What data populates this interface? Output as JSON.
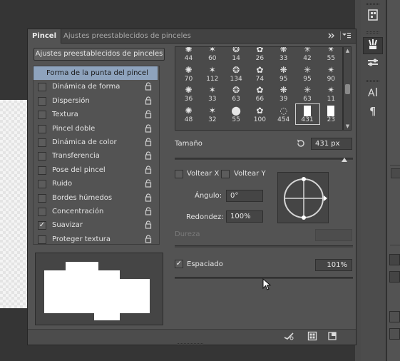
{
  "panel": {
    "tabs": [
      {
        "label": "Pincel",
        "active": true
      },
      {
        "label": "Ajustes preestablecidos de pinceles",
        "active": false
      }
    ],
    "collapse_icon": "double-chevron-right-icon",
    "menu_icon": "panel-menu-icon"
  },
  "presets_button": "Ajustes preestablecidos de pinceles",
  "options": [
    {
      "label": "Forma de la punta del pincel",
      "selected": true,
      "checkbox": false,
      "lock": false
    },
    {
      "label": "Dinámica de forma",
      "checked": false,
      "lock": true
    },
    {
      "label": "Dispersión",
      "checked": false,
      "lock": true
    },
    {
      "label": "Textura",
      "checked": false,
      "lock": true
    },
    {
      "label": "Pincel doble",
      "checked": false,
      "lock": true
    },
    {
      "label": "Dinámica de color",
      "checked": false,
      "lock": true
    },
    {
      "label": "Transferencia",
      "checked": false,
      "lock": true
    },
    {
      "label": "Pose del pincel",
      "checked": false,
      "lock": true
    },
    {
      "label": "Ruido",
      "checked": false,
      "lock": true
    },
    {
      "label": "Bordes húmedos",
      "checked": false,
      "lock": true
    },
    {
      "label": "Concentración",
      "checked": false,
      "lock": true
    },
    {
      "label": "Suavizar",
      "checked": true,
      "lock": true
    },
    {
      "label": "Proteger textura",
      "checked": false,
      "lock": true
    }
  ],
  "tips": [
    {
      "size": "44"
    },
    {
      "size": "60"
    },
    {
      "size": "14"
    },
    {
      "size": "26"
    },
    {
      "size": "33"
    },
    {
      "size": "42"
    },
    {
      "size": "55"
    },
    {
      "size": "70"
    },
    {
      "size": "112"
    },
    {
      "size": "134"
    },
    {
      "size": "74"
    },
    {
      "size": "95"
    },
    {
      "size": "95"
    },
    {
      "size": "90"
    },
    {
      "size": "36"
    },
    {
      "size": "33"
    },
    {
      "size": "63"
    },
    {
      "size": "66"
    },
    {
      "size": "39"
    },
    {
      "size": "63"
    },
    {
      "size": "11"
    },
    {
      "size": "48"
    },
    {
      "size": "32"
    },
    {
      "size": "55"
    },
    {
      "size": "100"
    },
    {
      "size": "454"
    },
    {
      "size": "431"
    },
    {
      "size": "23"
    }
  ],
  "selected_tip_index": 26,
  "size": {
    "label": "Tamaño",
    "value": "431 px"
  },
  "flip_x": {
    "label": "Voltear X",
    "checked": false
  },
  "flip_y": {
    "label": "Voltear Y",
    "checked": false
  },
  "angle": {
    "label": "Ángulo:",
    "value": "0°"
  },
  "roundness": {
    "label": "Redondez:",
    "value": "100%"
  },
  "hardness": {
    "label": "Dureza"
  },
  "spacing": {
    "label": "Espaciado",
    "checked": true,
    "value": "101%"
  },
  "sliders": {
    "size_level": 0.95,
    "spacing_level": 0.52
  },
  "colors": {
    "selection_highlight": "#8ea3bd",
    "panel_bg": "#535353"
  }
}
